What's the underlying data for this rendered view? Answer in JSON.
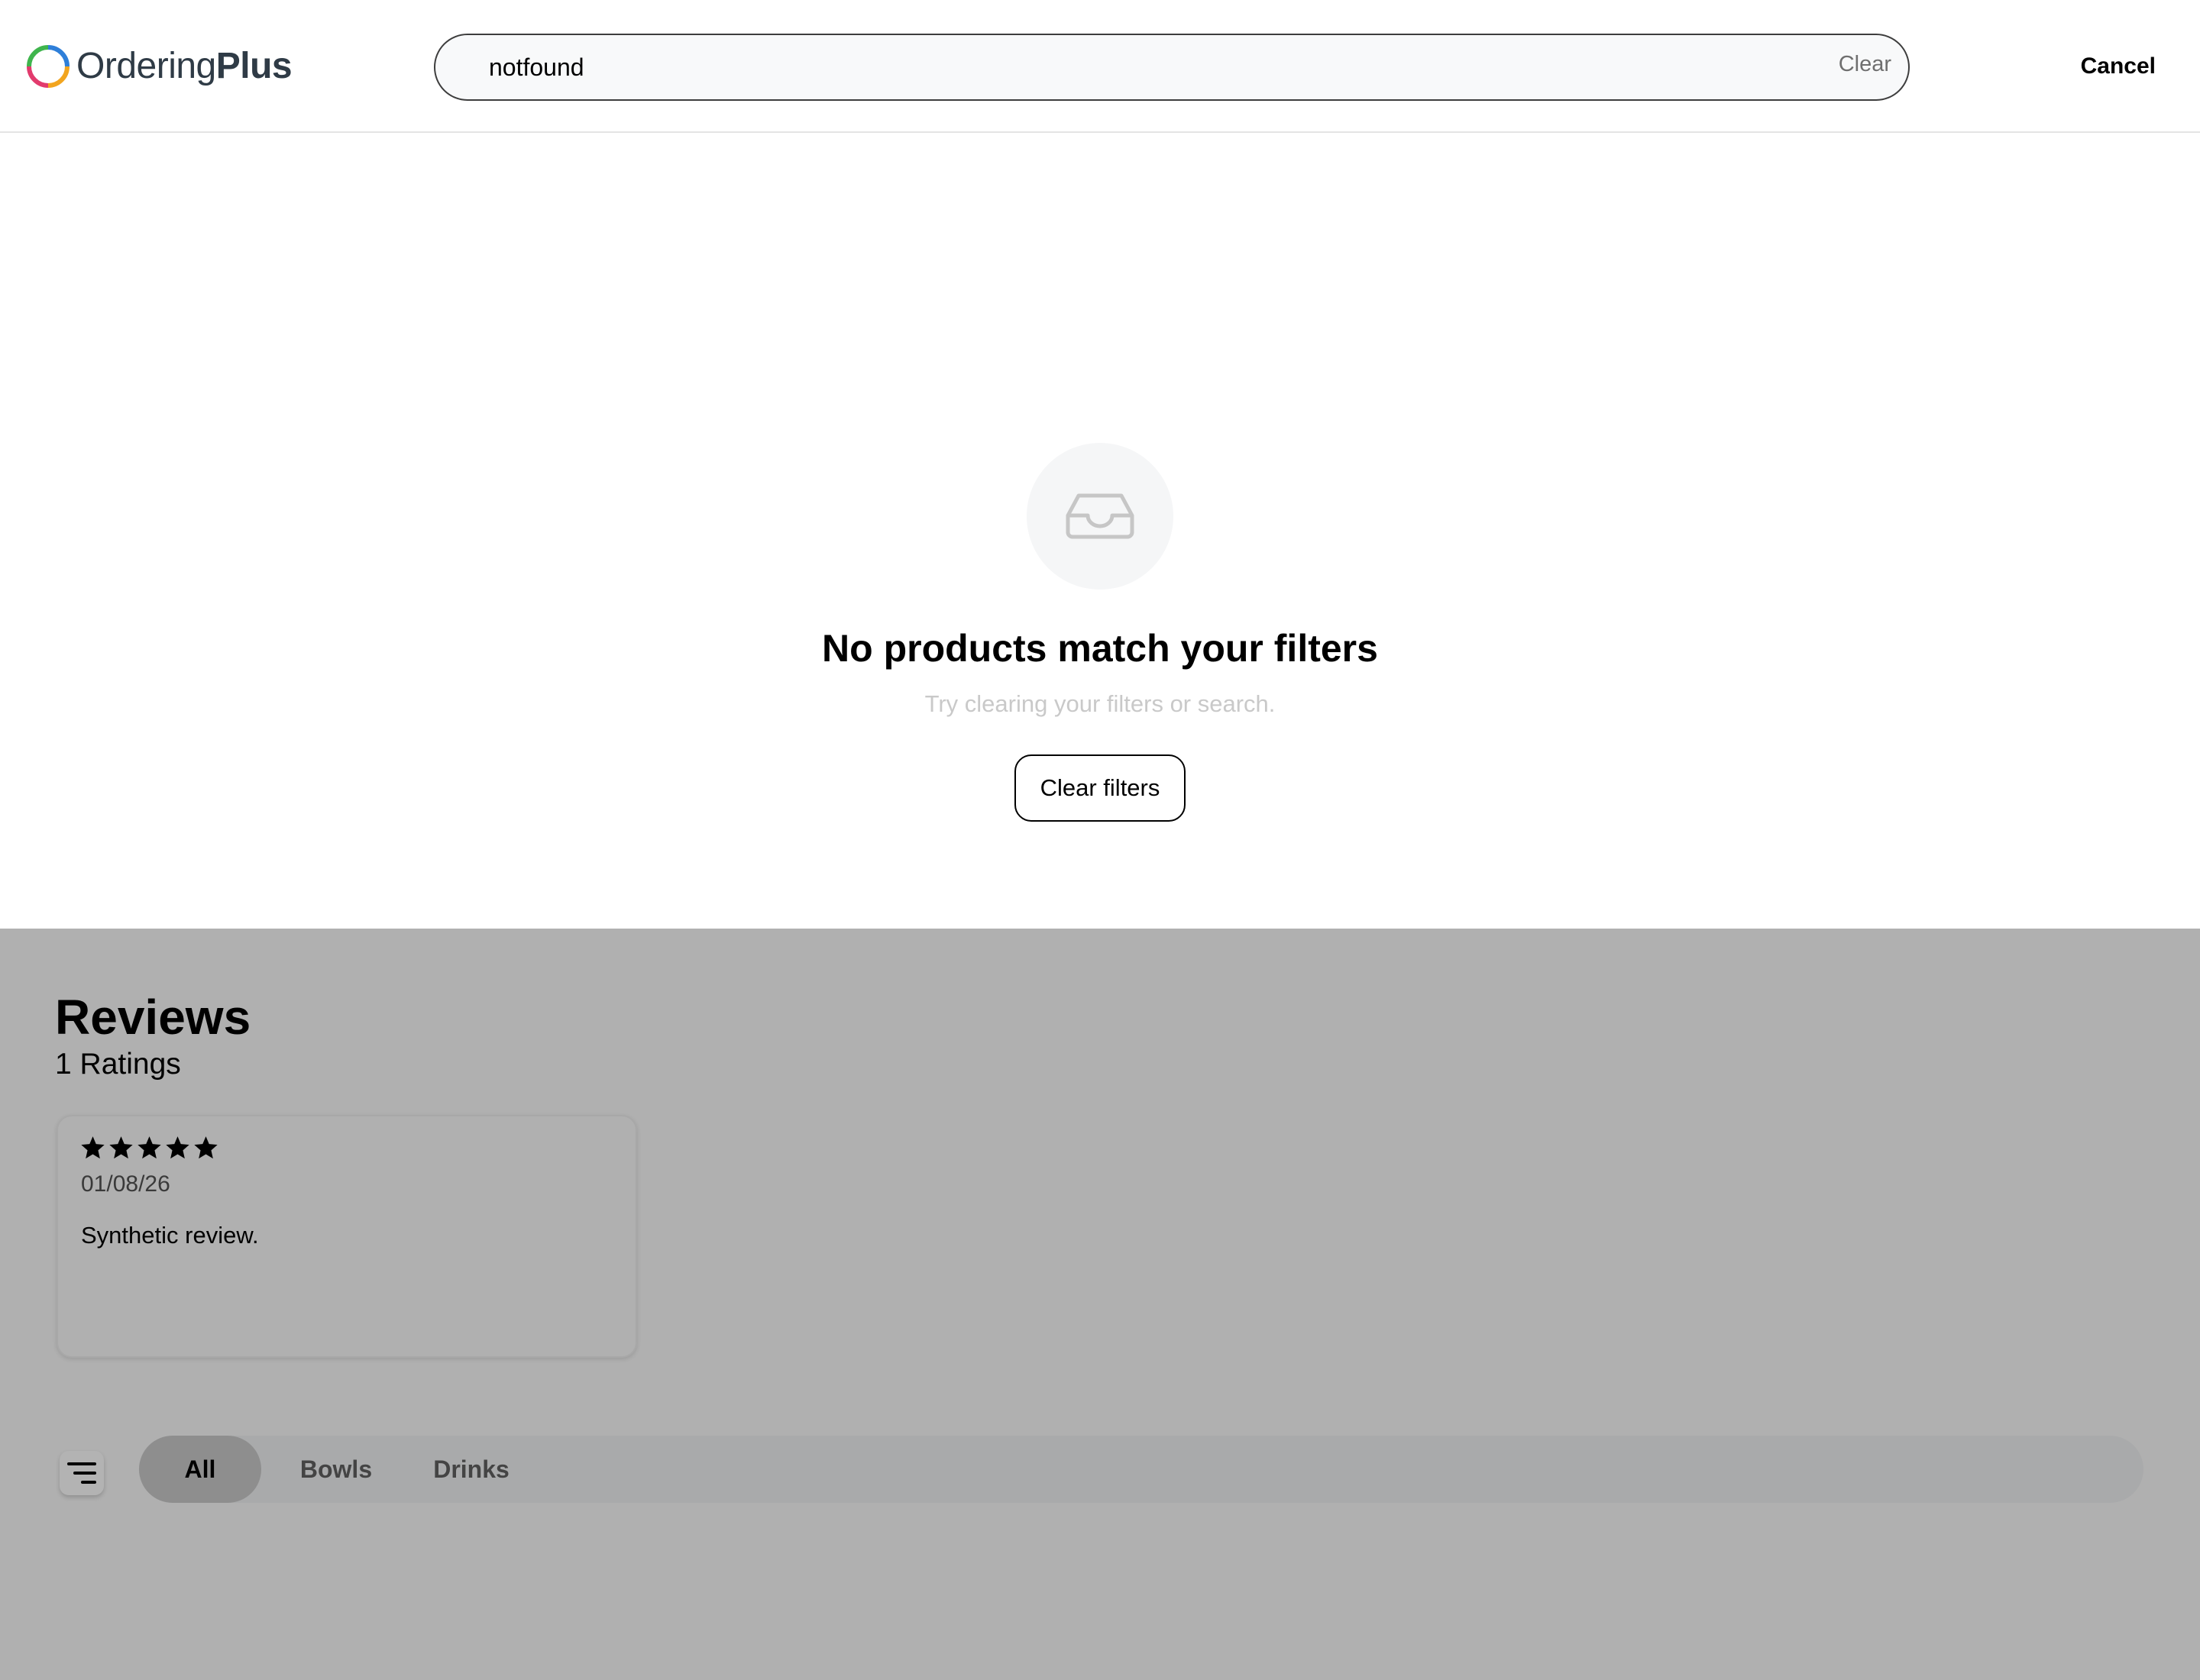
{
  "brand": {
    "name_regular": "Ordering",
    "name_bold": "Plus",
    "logo_colors": [
      "#2e7fd9",
      "#3fb54d",
      "#f2a51f",
      "#e23b6d"
    ]
  },
  "search": {
    "value": "notfound",
    "clear_label": "Clear"
  },
  "header": {
    "cancel_label": "Cancel"
  },
  "empty_state": {
    "icon": "inbox-icon",
    "title": "No products match your filters",
    "subtitle": "Try clearing your filters or search.",
    "button_label": "Clear filters"
  },
  "reviews": {
    "title": "Reviews",
    "count_label": "1 Ratings",
    "items": [
      {
        "rating": 5,
        "rating_max": 5,
        "date": "01/08/26",
        "text": "Synthetic review."
      }
    ]
  },
  "categories": {
    "filter_icon": "filter-lines-icon",
    "items": [
      {
        "label": "All",
        "active": true
      },
      {
        "label": "Bowls",
        "active": false
      },
      {
        "label": "Drinks",
        "active": false
      }
    ]
  }
}
